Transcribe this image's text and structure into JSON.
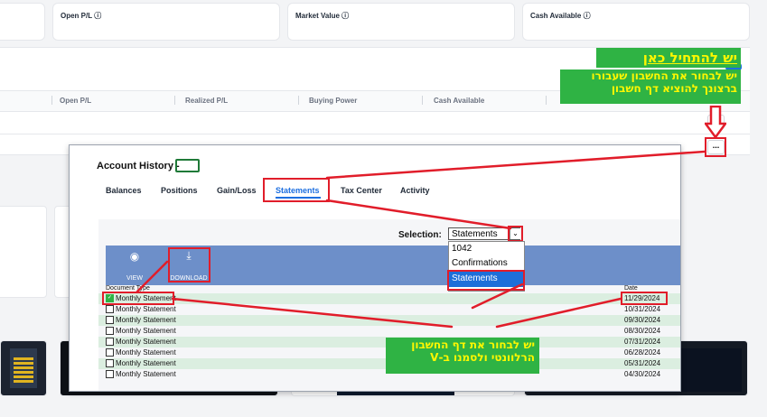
{
  "summary_cards": [
    {
      "label": "Open P/L"
    },
    {
      "label": "Market Value"
    },
    {
      "label": "Cash Available"
    }
  ],
  "info_glyph": "ⓘ",
  "table_headers": [
    "Open P/L",
    "Realized P/L",
    "Buying Power",
    "Cash Available"
  ],
  "more_button_label": "...",
  "annotations": {
    "start_here": "יש להתחיל כאן",
    "choose_account": "יש לבחור את החשבון שעבורו ברצונך להוציא דף חשבון",
    "choose_statement": "יש לבחור את דף החשבון הרלוונטי ולסמנו ב-V"
  },
  "modal": {
    "title": "Account History -",
    "tabs": [
      "Balances",
      "Positions",
      "Gain/Loss",
      "Statements",
      "Tax Center",
      "Activity"
    ],
    "active_tab": "Statements",
    "selection_label": "Selection:",
    "selection_value": "Statements",
    "dropdown_options": [
      "1042",
      "Confirmations",
      "Statements"
    ],
    "actions": {
      "view": "VIEW",
      "download": "DOWNLOAD"
    },
    "columns": {
      "type": "Document Type",
      "date": "Date"
    },
    "rows": [
      {
        "type": "Monthly Statement",
        "date": "11/29/2024",
        "checked": true
      },
      {
        "type": "Monthly Statement",
        "date": "10/31/2024",
        "checked": false
      },
      {
        "type": "Monthly Statement",
        "date": "09/30/2024",
        "checked": false
      },
      {
        "type": "Monthly Statement",
        "date": "08/30/2024",
        "checked": false
      },
      {
        "type": "Monthly Statement",
        "date": "07/31/2024",
        "checked": false
      },
      {
        "type": "Monthly Statement",
        "date": "06/28/2024",
        "checked": false
      },
      {
        "type": "Monthly Statement",
        "date": "05/31/2024",
        "checked": false
      },
      {
        "type": "Monthly Statement",
        "date": "04/30/2024",
        "checked": false
      }
    ]
  },
  "colors": {
    "annotation_red": "#e11d2a",
    "annotation_green": "#2fb344",
    "annotation_yellow": "#fff700",
    "active_tab_blue": "#1d6fe0",
    "toolbar_blue": "#6d8fc9",
    "row_stripe": "#dbeee0"
  }
}
